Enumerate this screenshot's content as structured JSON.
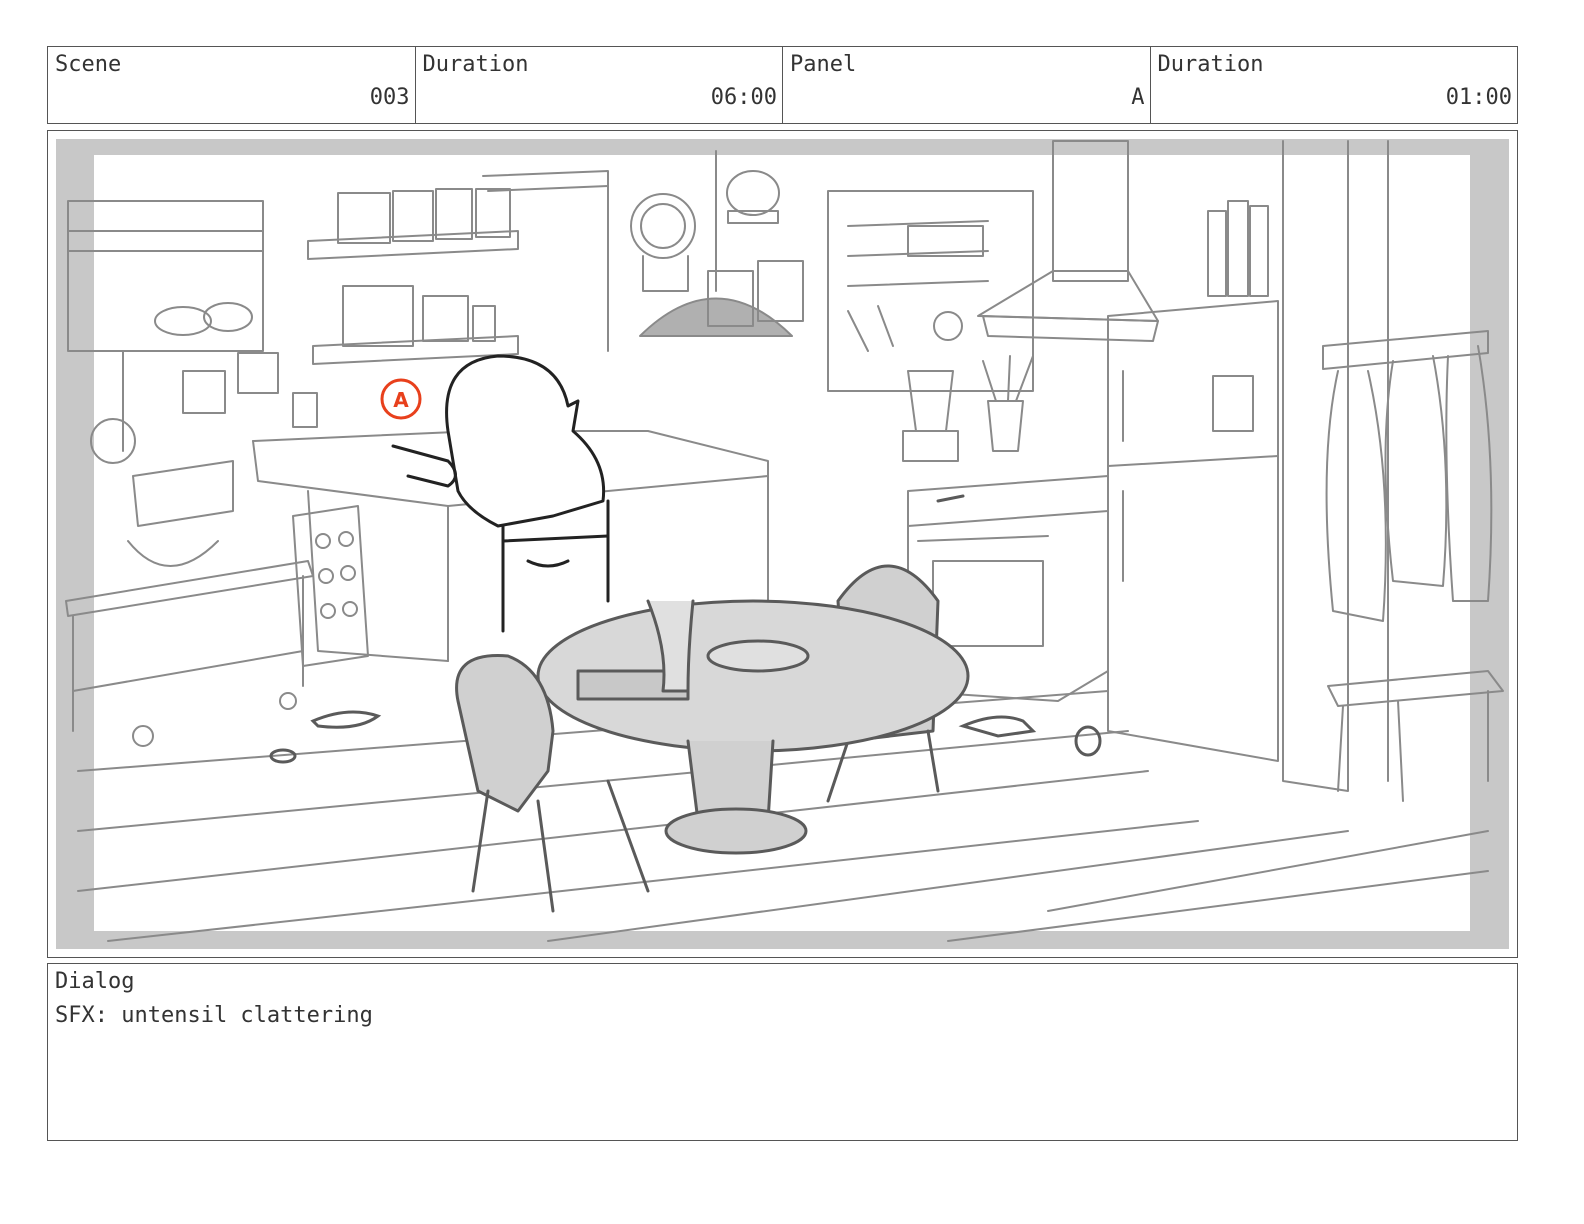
{
  "header": {
    "cells": [
      {
        "label": "Scene",
        "value": "003"
      },
      {
        "label": "Duration",
        "value": "06:00"
      },
      {
        "label": "Panel",
        "value": "A"
      },
      {
        "label": "Duration",
        "value": "01:00"
      }
    ]
  },
  "panel": {
    "marker_letter": "A",
    "marker_color": "#e8401c"
  },
  "dialog": {
    "label": "Dialog",
    "text": "SFX: untensil clattering"
  }
}
